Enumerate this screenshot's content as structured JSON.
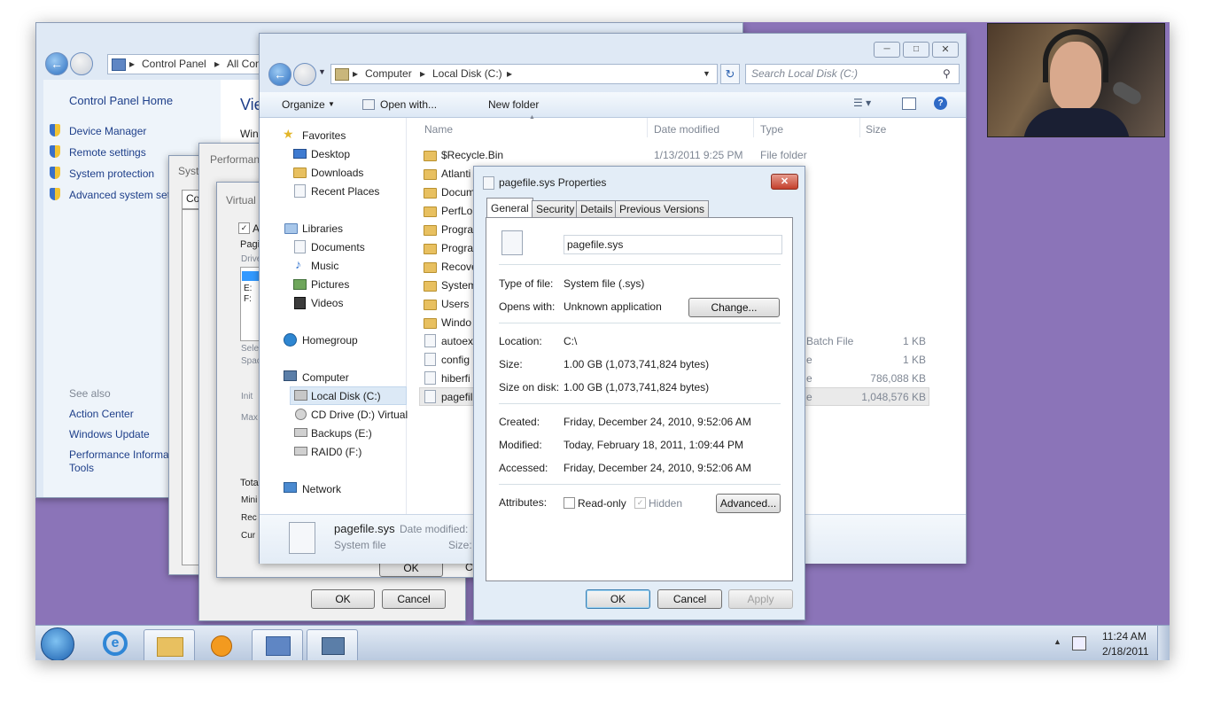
{
  "colors": {
    "desktop": "#8b74b8",
    "taskbar": "#cfd9e8",
    "accent": "#3c7fb1"
  },
  "control_panel": {
    "address": [
      "Control Panel",
      "All Con"
    ],
    "home": "Control Panel Home",
    "view_heading": "Vie",
    "win_label": "Win",
    "tasks": [
      {
        "label": "Device Manager",
        "icon": "shield-icon"
      },
      {
        "label": "Remote settings",
        "icon": "shield-icon"
      },
      {
        "label": "System protection",
        "icon": "shield-icon"
      },
      {
        "label": "Advanced system sett",
        "icon": "shield-icon"
      }
    ],
    "see_also": "See also",
    "see_also_items": [
      "Action Center",
      "Windows Update",
      "Performance Informa Tools"
    ]
  },
  "system_props": {
    "title": "Syst",
    "tab": "Co"
  },
  "perf_options": {
    "title": "Performan",
    "ok": "OK",
    "cancel": "Cancel"
  },
  "virtual_memory": {
    "title": "Virtual",
    "auto_check": "A",
    "paging": "Pagi",
    "drive_hdr": "Drive",
    "drives": [
      "E:",
      "F:"
    ],
    "sel_label": "Sele",
    "space_label": "Spac",
    "init_label": "Init",
    "max_label": "Max",
    "total_label": "Tota",
    "min_label": "Mini",
    "rec_label": "Rec",
    "cur_label": "Cur",
    "ok": "OK",
    "c_label": "C"
  },
  "explorer": {
    "breadcrumb": [
      "Computer",
      "Local Disk (C:)"
    ],
    "search_placeholder": "Search Local Disk (C:)",
    "toolbar": {
      "organize": "Organize",
      "open_with": "Open with...",
      "new_folder": "New folder"
    },
    "nav": {
      "favorites": "Favorites",
      "fav_items": [
        "Desktop",
        "Downloads",
        "Recent Places"
      ],
      "libraries": "Libraries",
      "lib_items": [
        "Documents",
        "Music",
        "Pictures",
        "Videos"
      ],
      "homegroup": "Homegroup",
      "computer": "Computer",
      "comp_items": [
        "Local Disk (C:)",
        "CD Drive (D:) Virtual",
        "Backups (E:)",
        "RAID0 (F:)"
      ],
      "network": "Network"
    },
    "columns": {
      "name": "Name",
      "date": "Date modified",
      "type": "Type",
      "size": "Size"
    },
    "files": [
      {
        "name": "$Recycle.Bin",
        "date": "1/13/2011 9:25 PM",
        "type": "File folder",
        "size": ""
      },
      {
        "name": "Atlanti",
        "date": "",
        "type": "",
        "size": ""
      },
      {
        "name": "Docum",
        "date": "",
        "type": "",
        "size": ""
      },
      {
        "name": "PerfLo",
        "date": "",
        "type": "",
        "size": ""
      },
      {
        "name": "Progra",
        "date": "",
        "type": "",
        "size": ""
      },
      {
        "name": "Progra",
        "date": "",
        "type": "",
        "size": ""
      },
      {
        "name": "Recove",
        "date": "",
        "type": "",
        "size": ""
      },
      {
        "name": "System",
        "date": "",
        "type": "",
        "size": ""
      },
      {
        "name": "Users",
        "date": "",
        "type": "",
        "size": ""
      },
      {
        "name": "Windo",
        "date": "",
        "type": "",
        "size": ""
      },
      {
        "name": "autoex",
        "date": "",
        "type": "Batch File",
        "size": "1 KB"
      },
      {
        "name": "config",
        "date": "",
        "type": "e",
        "size": "1 KB"
      },
      {
        "name": "hiberfi",
        "date": "",
        "type": "e",
        "size": "786,088 KB"
      },
      {
        "name": "pagefil",
        "date": "",
        "type": "e",
        "size": "1,048,576 KB"
      }
    ],
    "details": {
      "name": "pagefile.sys",
      "type": "System file",
      "date_label": "Date modified:",
      "size_label": "Size:"
    }
  },
  "props": {
    "title": "pagefile.sys Properties",
    "tabs": [
      "General",
      "Security",
      "Details",
      "Previous Versions"
    ],
    "filename": "pagefile.sys",
    "type_label": "Type of file:",
    "type_value": "System file (.sys)",
    "opens_label": "Opens with:",
    "opens_value": "Unknown application",
    "change": "Change...",
    "location_label": "Location:",
    "location_value": "C:\\",
    "size_label": "Size:",
    "size_value": "1.00 GB (1,073,741,824 bytes)",
    "sizeondisk_label": "Size on disk:",
    "sizeondisk_value": "1.00 GB (1,073,741,824 bytes)",
    "created_label": "Created:",
    "created_value": "Friday, December 24, 2010, 9:52:06 AM",
    "modified_label": "Modified:",
    "modified_value": "Today, February 18, 2011, 1:09:44 PM",
    "accessed_label": "Accessed:",
    "accessed_value": "Friday, December 24, 2010, 9:52:06 AM",
    "attributes_label": "Attributes:",
    "readonly": "Read-only",
    "hidden": "Hidden",
    "advanced": "Advanced...",
    "ok": "OK",
    "cancel": "Cancel",
    "apply": "Apply"
  },
  "taskbar": {
    "time": "11:24 AM",
    "date": "2/18/2011"
  }
}
